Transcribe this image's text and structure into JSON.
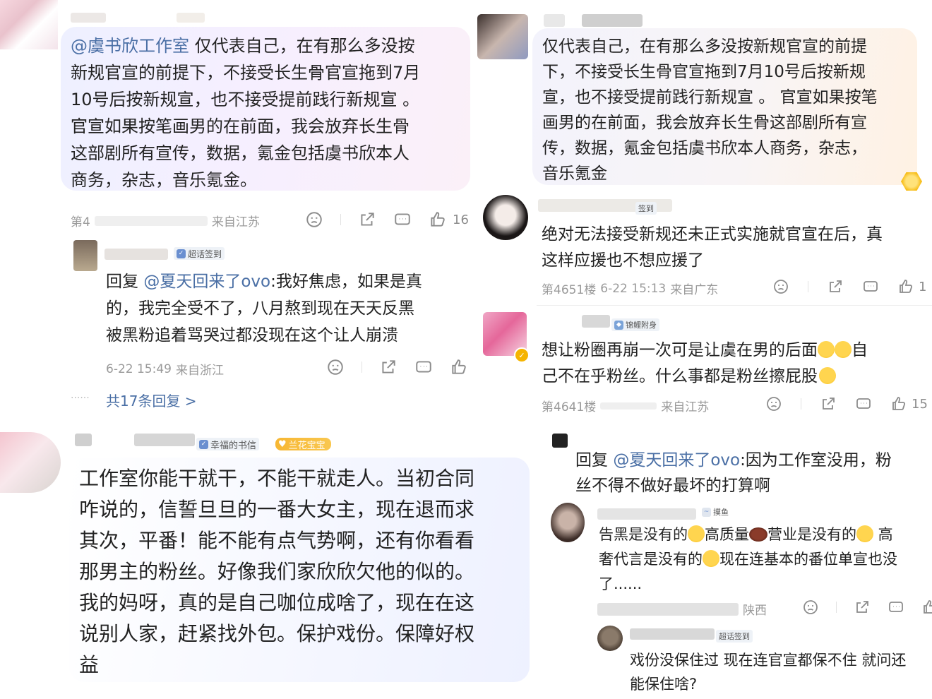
{
  "panel_tl": {
    "mention": "@虞书欣工作室",
    "text": " 仅代表自己，在有那么多没按\n新规官宣的前提下，不接受长生骨官宣拖到7月\n10号后按新规宣，也不接受提前践行新规宣 。\n官宣如果按笔画男的在前面，我会放弃长生骨\n这部剧所有宣传，数据，氪金包括虞书欣本人\n商务，杂志，音乐氪金。",
    "floor": "第4",
    "location": "来自江苏",
    "like_count": "16",
    "reply_badge": "超话签到",
    "reply_prefix": "回复 ",
    "reply_mention": "@夏天回来了ovo",
    "reply_text": ":我好焦虑，如果是真\n的，我完全受不了，八月熬到现在天天反黑\n被黑粉追着骂哭过都没现在这个让人崩溃",
    "reply_time": "6-22 15:49",
    "reply_location": "来自浙江",
    "more_replies": "共17条回复 >",
    "dots": "······"
  },
  "panel_tr": {
    "text": "仅代表自己，在有那么多没按新规官宣的前提\n下，不接受长生骨官宣拖到7月10号后按新规\n宣，也不接受提前践行新规宣 。 官宣如果按笔\n画男的在前面，我会放弃长生骨这部剧所有宣\n传，数据，氪金包括虞书欣本人商务，杂志，\n音乐氪金"
  },
  "panel_mr1": {
    "badge": "签到",
    "text": "绝对无法接受新规还未正式实施就官宣在后，真\n这样应援也不想应援了",
    "floor": "第4651楼",
    "time": "6-22 15:13",
    "location": "来自广东",
    "like_count": "1"
  },
  "panel_mr2": {
    "badge": "锦鲤附身",
    "text_a": "想让粉圈再崩一次可是让虞在男的后面",
    "text_b": "自\n己不在乎粉丝。什么事都是粉丝擦屁股",
    "floor": "第4641楼",
    "location": "来自江苏",
    "like_count": "15"
  },
  "panel_bl": {
    "badge1": "幸福的书信",
    "badge2": "兰花宝宝",
    "text": "工作室你能干就干，不能干就走人。当初合同\n咋说的，信誓旦旦的一番大女主，现在退而求\n其次，平番！能不能有点气势啊，还有你看看\n那男主的粉丝。好像我们家欣欣欠他的似的。\n我的妈呀，真的是自己咖位成啥了，现在在这\n说别人家，赶紧找外包。保护戏份。保障好权\n益"
  },
  "panel_br": {
    "reply_prefix": "回复 ",
    "reply_mention": "@夏天回来了ovo",
    "reply_text": ":因为工作室没用，粉\n丝不得不做好最坏的打算啊",
    "sub1_badge": "摸鱼",
    "sub1_a": "告黑是没有的",
    "sub1_b": "高质量",
    "sub1_c": "营业是没有的",
    "sub1_d": " 高",
    "sub1_e": "奢代言是没有的",
    "sub1_f": "现在连基本的番位单宣也没\n了......",
    "sub1_location": "陕西",
    "sub2_badge": "超话签到",
    "sub2_text": "戏份没保住过 现在连官宣都保不住 就问还\n能保住啥?"
  }
}
